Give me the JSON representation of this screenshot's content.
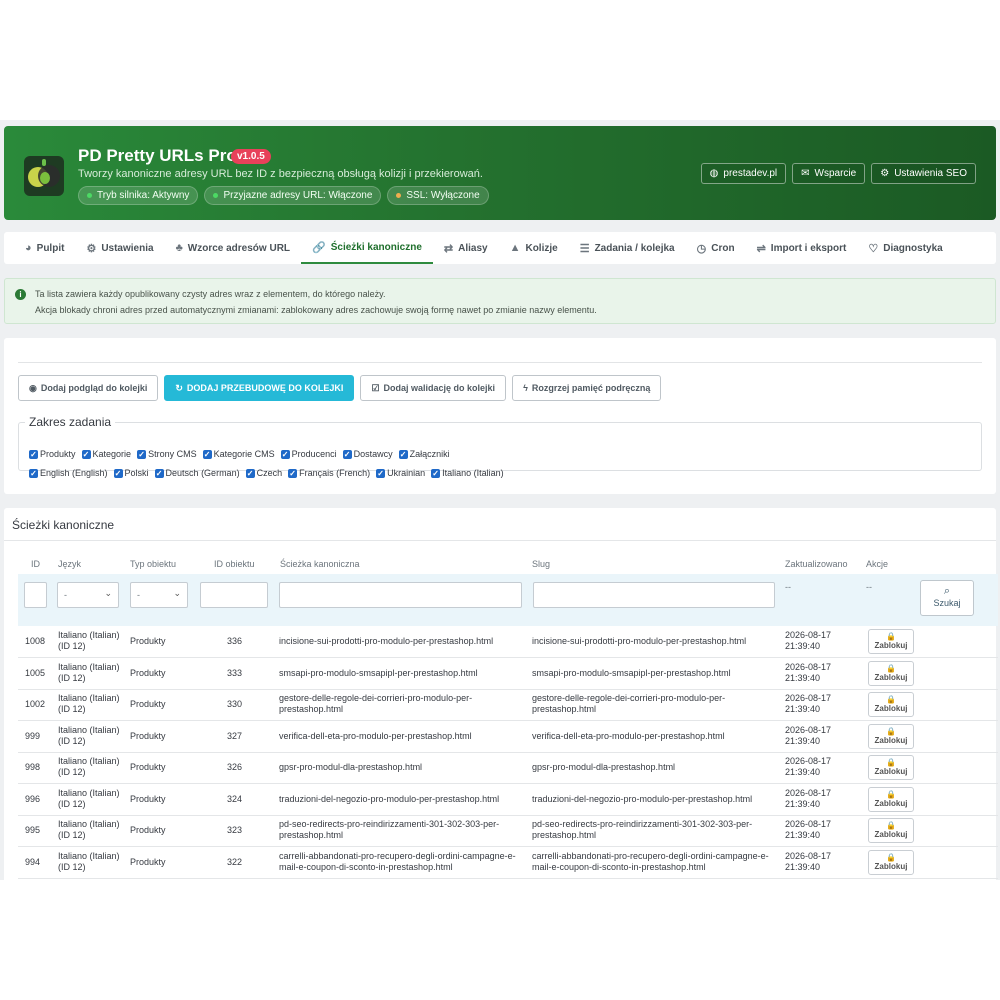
{
  "header": {
    "title": "PD Pretty URLs Pro",
    "version": "v1.0.5",
    "subtitle": "Tworzy kanoniczne adresy URL bez ID z bezpieczną obsługą kolizji i przekierowań.",
    "chips": [
      {
        "label": "Tryb silnika: Aktywny",
        "color": "#4cd964"
      },
      {
        "label": "Przyjazne adresy URL: Włączone",
        "color": "#4cd964"
      },
      {
        "label": "SSL: Wyłączone",
        "color": "#f0ad4e"
      }
    ],
    "buttons": [
      {
        "label": "prestadev.pl",
        "icon": "globe-icon"
      },
      {
        "label": "Wsparcie",
        "icon": "envelope-icon"
      },
      {
        "label": "Ustawienia SEO",
        "icon": "gears-icon"
      }
    ]
  },
  "tabs": [
    {
      "label": "Pulpit",
      "icon": "dashboard-icon",
      "glyph": "◕"
    },
    {
      "label": "Ustawienia",
      "icon": "gears-icon",
      "glyph": "⚙"
    },
    {
      "label": "Wzorce adresów URL",
      "icon": "sitemap-icon",
      "glyph": "♣"
    },
    {
      "label": "Ścieżki kanoniczne",
      "icon": "link-icon",
      "glyph": "🔗",
      "active": true
    },
    {
      "label": "Aliasy",
      "icon": "random-icon",
      "glyph": "⇄"
    },
    {
      "label": "Kolizje",
      "icon": "warning-icon",
      "glyph": "▲"
    },
    {
      "label": "Zadania / kolejka",
      "icon": "list-icon",
      "glyph": "☰"
    },
    {
      "label": "Cron",
      "icon": "clock-icon",
      "glyph": "◷"
    },
    {
      "label": "Import i eksport",
      "icon": "exchange-icon",
      "glyph": "⇌"
    },
    {
      "label": "Diagnostyka",
      "icon": "stethoscope-icon",
      "glyph": "♡"
    }
  ],
  "alert": {
    "line1": "Ta lista zawiera każdy opublikowany czysty adres wraz z elementem, do którego należy.",
    "line2": "Akcja blokady chroni adres przed automatycznymi zmianami: zablokowany adres zachowuje swoją formę nawet po zmianie nazwy elementu."
  },
  "actions": {
    "buttons": [
      {
        "label": "Dodaj podgląd do kolejki",
        "icon": "eye-icon",
        "glyph": "◉",
        "primary": false
      },
      {
        "label": "DODAJ PRZEBUDOWĘ DO KOLEJKI",
        "icon": "refresh-icon",
        "glyph": "↻",
        "primary": true
      },
      {
        "label": "Dodaj walidację do kolejki",
        "icon": "check-square-icon",
        "glyph": "☑",
        "primary": false
      },
      {
        "label": "Rozgrzej pamięć podręczną",
        "icon": "bolt-icon",
        "glyph": "ϟ",
        "primary": false
      }
    ],
    "scope_title": "Zakres zadania",
    "entities": [
      "Produkty",
      "Kategorie",
      "Strony CMS",
      "Kategorie CMS",
      "Producenci",
      "Dostawcy",
      "Załączniki"
    ],
    "languages": [
      "English (English)",
      "Polski",
      "Deutsch (German)",
      "Czech",
      "Français (French)",
      "Ukrainian",
      "Italiano (Italian)"
    ]
  },
  "table": {
    "title": "Ścieżki kanoniczne",
    "columns": [
      "ID",
      "Język",
      "Typ obiektu",
      "ID obiektu",
      "Ścieżka kanoniczna",
      "Slug",
      "Zaktualizowano",
      "Akcje"
    ],
    "filters": {
      "lang_value": "-",
      "type_value": "-",
      "updated_placeholder": "--",
      "actions_placeholder": "--",
      "search_label": "Szukaj"
    },
    "lock_label": "Zablokuj",
    "rows": [
      {
        "id": "1008",
        "lang1": "Italiano (Italian)",
        "lang2": "(ID 12)",
        "type": "Produkty",
        "obj": "336",
        "path1": "incisione-sui-prodotti-pro-modulo-per-prestashop.html",
        "path2": "",
        "slug1": "incisione-sui-prodotti-pro-modulo-per-prestashop.html",
        "slug2": "",
        "date": "2026-08-17",
        "time": "21:39:40"
      },
      {
        "id": "1005",
        "lang1": "Italiano (Italian)",
        "lang2": "(ID 12)",
        "type": "Produkty",
        "obj": "333",
        "path1": "smsapi-pro-modulo-smsapipl-per-prestashop.html",
        "path2": "",
        "slug1": "smsapi-pro-modulo-smsapipl-per-prestashop.html",
        "slug2": "",
        "date": "2026-08-17",
        "time": "21:39:40"
      },
      {
        "id": "1002",
        "lang1": "Italiano (Italian)",
        "lang2": "(ID 12)",
        "type": "Produkty",
        "obj": "330",
        "path1": "gestore-delle-regole-dei-corrieri-pro-modulo-per-",
        "path2": "prestashop.html",
        "slug1": "gestore-delle-regole-dei-corrieri-pro-modulo-per-",
        "slug2": "prestashop.html",
        "date": "2026-08-17",
        "time": "21:39:40"
      },
      {
        "id": "999",
        "lang1": "Italiano (Italian)",
        "lang2": "(ID 12)",
        "type": "Produkty",
        "obj": "327",
        "path1": "verifica-dell-eta-pro-modulo-per-prestashop.html",
        "path2": "",
        "slug1": "verifica-dell-eta-pro-modulo-per-prestashop.html",
        "slug2": "",
        "date": "2026-08-17",
        "time": "21:39:40"
      },
      {
        "id": "998",
        "lang1": "Italiano (Italian)",
        "lang2": "(ID 12)",
        "type": "Produkty",
        "obj": "326",
        "path1": "gpsr-pro-modul-dla-prestashop.html",
        "path2": "",
        "slug1": "gpsr-pro-modul-dla-prestashop.html",
        "slug2": "",
        "date": "2026-08-17",
        "time": "21:39:40"
      },
      {
        "id": "996",
        "lang1": "Italiano (Italian)",
        "lang2": "(ID 12)",
        "type": "Produkty",
        "obj": "324",
        "path1": "traduzioni-del-negozio-pro-modulo-per-prestashop.html",
        "path2": "",
        "slug1": "traduzioni-del-negozio-pro-modulo-per-prestashop.html",
        "slug2": "",
        "date": "2026-08-17",
        "time": "21:39:40"
      },
      {
        "id": "995",
        "lang1": "Italiano (Italian)",
        "lang2": "(ID 12)",
        "type": "Produkty",
        "obj": "323",
        "path1": "pd-seo-redirects-pro-reindirizzamenti-301-302-303-per-",
        "path2": "prestashop.html",
        "slug1": "pd-seo-redirects-pro-reindirizzamenti-301-302-303-per-",
        "slug2": "prestashop.html",
        "date": "2026-08-17",
        "time": "21:39:40"
      },
      {
        "id": "994",
        "lang1": "Italiano (Italian)",
        "lang2": "(ID 12)",
        "type": "Produkty",
        "obj": "322",
        "path1": "carrelli-abbandonati-pro-recupero-degli-ordini-campagne-e-",
        "path2": "mail-e-coupon-di-sconto-in-prestashop.html",
        "slug1": "carrelli-abbandonati-pro-recupero-degli-ordini-campagne-e-",
        "slug2": "mail-e-coupon-di-sconto-in-prestashop.html",
        "date": "2026-08-17",
        "time": "21:39:40"
      }
    ]
  }
}
